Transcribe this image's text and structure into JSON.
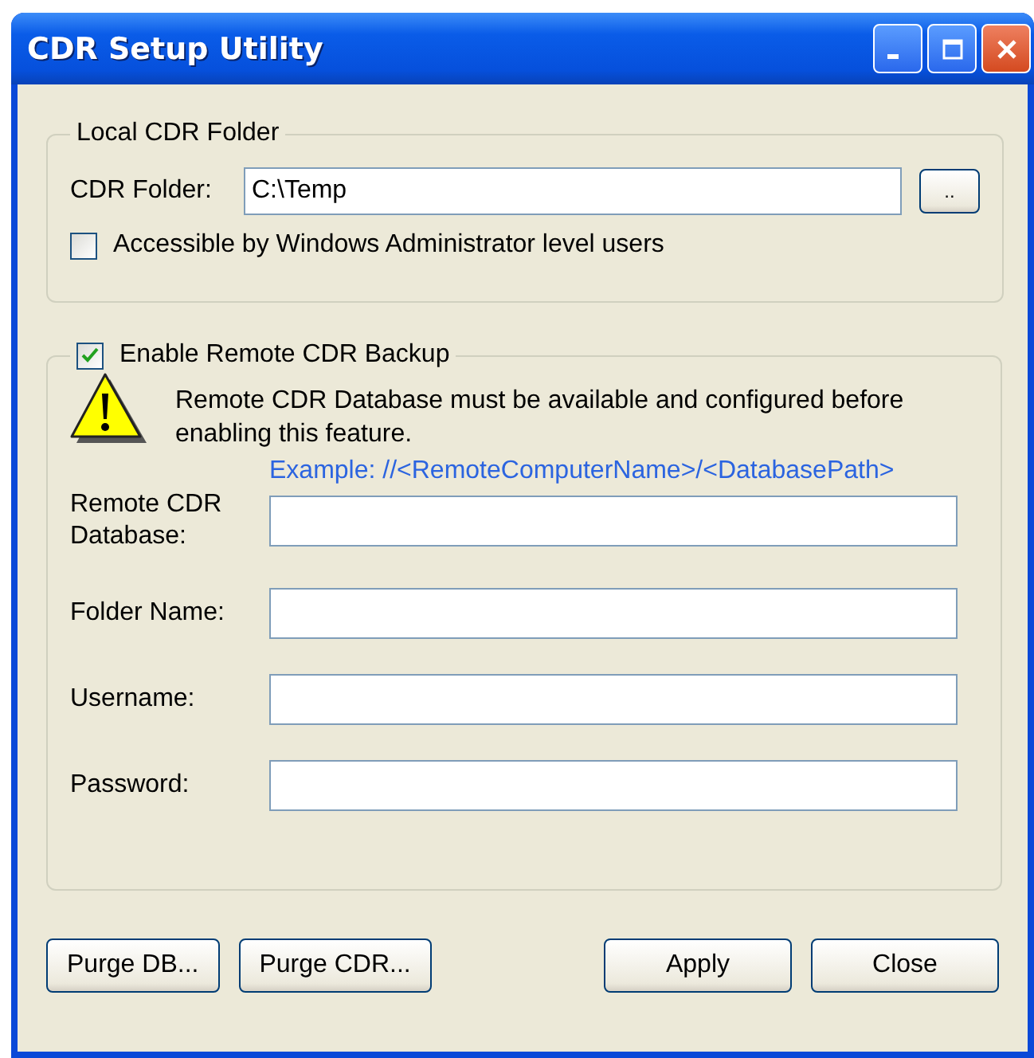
{
  "window": {
    "title": "CDR Setup Utility"
  },
  "local_group": {
    "legend": "Local CDR Folder",
    "folder_label": "CDR Folder:",
    "folder_value": "C:\\Temp",
    "browse_button": "..",
    "admin_checkbox": {
      "label": "Accessible by Windows Administrator level users",
      "checked": false
    }
  },
  "remote_group": {
    "enable_checkbox": {
      "label": "Enable Remote CDR Backup",
      "checked": true
    },
    "warning": "Remote CDR Database must be available and configured before enabling this feature.",
    "example": "Example: //<RemoteComputerName>/<DatabasePath>",
    "fields": [
      {
        "label": "Remote CDR Database:"
      },
      {
        "label": "Folder Name:"
      },
      {
        "label": "Username:"
      },
      {
        "label": "Password:"
      }
    ]
  },
  "buttons_left": [
    "Purge DB...",
    "Purge CDR..."
  ],
  "buttons_right": [
    "Apply",
    "Close"
  ]
}
